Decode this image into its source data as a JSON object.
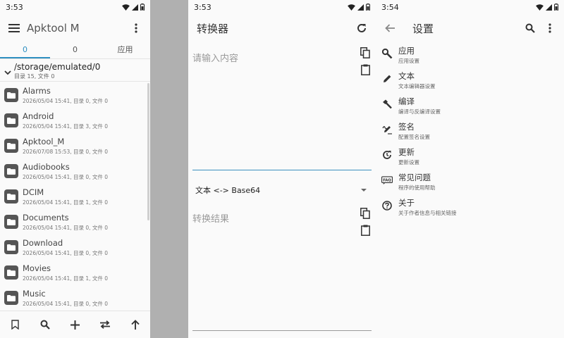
{
  "colors": {
    "accent": "#2f8fc1",
    "scrim": "#b0b0b0",
    "folder": "#555555"
  },
  "left": {
    "status_time": "3:53",
    "title": "Apktool M",
    "tabs": [
      {
        "label": "0"
      },
      {
        "label": "0"
      },
      {
        "label": "应用"
      }
    ],
    "path": "/storage/emulated/0",
    "path_summary": "目录 15, 文件 0",
    "files": [
      {
        "name": "Alarms",
        "meta": "2026/05/04 15:41, 目录 0, 文件 0"
      },
      {
        "name": "Android",
        "meta": "2026/05/04 15:41, 目录 3, 文件 0"
      },
      {
        "name": "Apktool_M",
        "meta": "2026/07/08 15:53, 目录 0, 文件 0"
      },
      {
        "name": "Audiobooks",
        "meta": "2026/05/04 15:41, 目录 0, 文件 0"
      },
      {
        "name": "DCIM",
        "meta": "2026/05/04 15:41, 目录 1, 文件 0"
      },
      {
        "name": "Documents",
        "meta": "2026/05/04 15:41, 目录 0, 文件 0"
      },
      {
        "name": "Download",
        "meta": "2026/05/04 15:41, 目录 0, 文件 0"
      },
      {
        "name": "Movies",
        "meta": "2026/05/04 15:41, 目录 1, 文件 0"
      },
      {
        "name": "Music",
        "meta": "2026/05/04 15:41, 目录 0, 文件 0"
      }
    ],
    "bottom_icons": [
      "bookmark-icon",
      "search-icon",
      "add-icon",
      "swap-icon",
      "arrow-up-icon"
    ]
  },
  "middle": {
    "status_time": "3:53",
    "title": "转换器",
    "input_placeholder": "请输入内容",
    "mode": "文本 <-> Base64",
    "result_placeholder": "转换结果"
  },
  "right": {
    "status_time": "3:54",
    "title": "设置",
    "items": [
      {
        "title": "应用",
        "subtitle": "应用设置",
        "icon": "wrench-icon"
      },
      {
        "title": "文本",
        "subtitle": "文本编辑器设置",
        "icon": "pencil-icon"
      },
      {
        "title": "编译",
        "subtitle": "编译与反编译设置",
        "icon": "hammer-icon"
      },
      {
        "title": "签名",
        "subtitle": "配置签名设置",
        "icon": "signature-icon"
      },
      {
        "title": "更新",
        "subtitle": "更新设置",
        "icon": "update-icon"
      },
      {
        "title": "常见问题",
        "subtitle": "程序的使用帮助",
        "icon": "faq-icon"
      },
      {
        "title": "关于",
        "subtitle": "关于作者信息与相关链接",
        "icon": "help-circle-icon"
      }
    ]
  }
}
